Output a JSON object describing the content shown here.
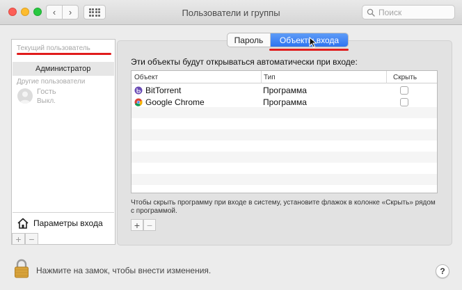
{
  "window": {
    "title": "Пользователи и группы"
  },
  "toolbar": {
    "back_glyph": "‹",
    "forward_glyph": "›"
  },
  "search": {
    "placeholder": "Поиск"
  },
  "sidebar": {
    "current_user_header": "Текущий пользователь",
    "current_user_name": "Администратор",
    "other_users_header": "Другие пользователи",
    "guest_name": "Гость",
    "guest_status": "Выкл.",
    "login_options_label": "Параметры входа",
    "add_glyph": "+",
    "remove_glyph": "−"
  },
  "tabs": [
    {
      "label": "Пароль",
      "selected": false
    },
    {
      "label": "Объекты входа",
      "selected": true
    }
  ],
  "login_items": {
    "heading": "Эти объекты будут открываться автоматически при входе:",
    "columns": {
      "item": "Объект",
      "type": "Тип",
      "hide": "Скрыть"
    },
    "rows": [
      {
        "name": "BitTorrent",
        "icon": "bittorrent-icon",
        "type": "Программа",
        "hide": false
      },
      {
        "name": "Google Chrome",
        "icon": "chrome-icon",
        "type": "Программа",
        "hide": false
      }
    ],
    "note": "Чтобы скрыть программу при входе в систему, установите флажок в колонке «Скрыть» рядом с программой.",
    "add_glyph": "+",
    "remove_glyph": "−"
  },
  "footer": {
    "lock_text": "Нажмите на замок, чтобы внести изменения.",
    "help_glyph": "?"
  },
  "colors": {
    "accent": "#2e74f0",
    "annotation_red": "#e01c1c",
    "window_bg": "#ececec"
  }
}
